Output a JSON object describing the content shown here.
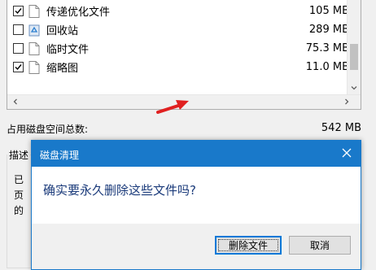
{
  "file_list": {
    "items": [
      {
        "name": "传递优化文件",
        "size": "105 MB",
        "checked": true,
        "icon": "file-icon"
      },
      {
        "name": "回收站",
        "size": "289 MB",
        "checked": false,
        "icon": "recycle-bin-icon"
      },
      {
        "name": "临时文件",
        "size": "75.3 MB",
        "checked": false,
        "icon": "file-icon"
      },
      {
        "name": "缩略图",
        "size": "11.0 MB",
        "checked": true,
        "icon": "file-icon"
      }
    ]
  },
  "total": {
    "label": "占用磁盘空间总数:",
    "value": "542 MB"
  },
  "description": {
    "title": "描述",
    "lines": [
      "已",
      "页",
      "的"
    ]
  },
  "dialog": {
    "title": "磁盘清理",
    "message": "确实要永久删除这些文件吗?",
    "delete_label": "删除文件",
    "cancel_label": "取消"
  },
  "colors": {
    "accent": "#1979ca",
    "button_focus": "#0078d7",
    "arrow": "#e02020"
  }
}
